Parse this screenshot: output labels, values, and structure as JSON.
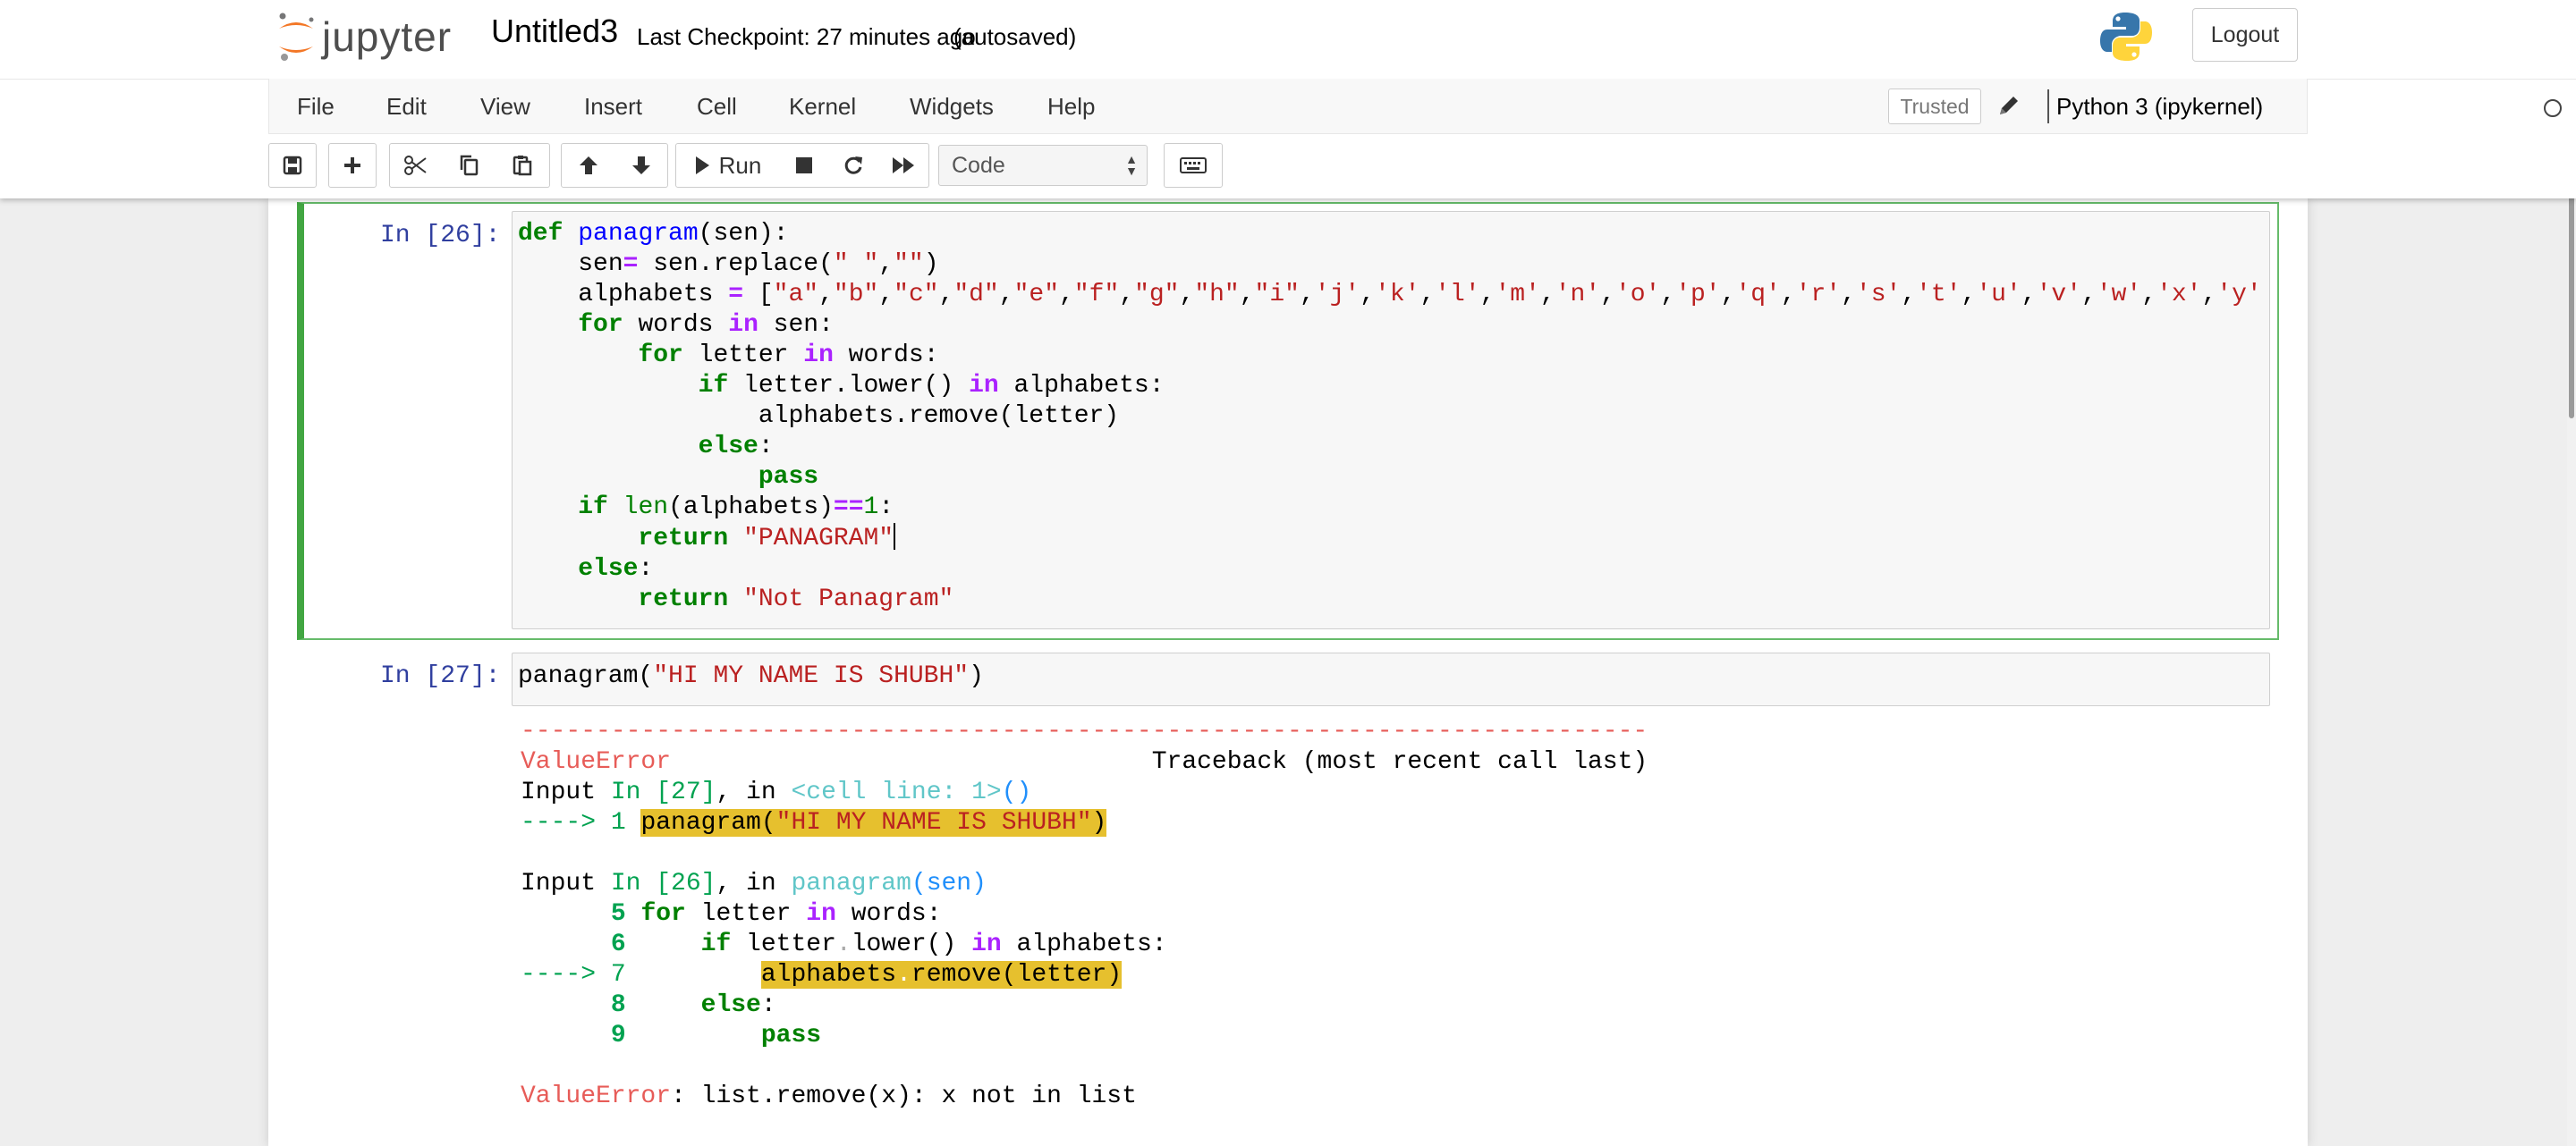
{
  "header": {
    "logo_text": "jupyter",
    "notebook_name": "Untitled3",
    "checkpoint": "Last Checkpoint: 27 minutes ago",
    "autosave": "(autosaved)",
    "logout_label": "Logout"
  },
  "menu": {
    "items": [
      "File",
      "Edit",
      "View",
      "Insert",
      "Cell",
      "Kernel",
      "Widgets",
      "Help"
    ],
    "trusted_label": "Trusted",
    "kernel_name": "Python 3 (ipykernel)"
  },
  "toolbar": {
    "run_label": "Run",
    "cell_type": "Code",
    "icons": [
      "save-icon",
      "plus-icon",
      "cut-icon",
      "copy-icon",
      "paste-icon",
      "arrow-up-icon",
      "arrow-down-icon",
      "run-icon",
      "stop-icon",
      "restart-icon",
      "fast-forward-icon",
      "keyboard-icon"
    ]
  },
  "cells": [
    {
      "prompt": "In [26]:",
      "code_lines": [
        "def panagram(sen):",
        "    sen= sen.replace(\" \",\"\")",
        "    alphabets = [\"a\",\"b\",\"c\",\"d\",\"e\",\"f\",\"g\",\"h\",\"i\",'j','k','l','m','n','o','p','q','r','s','t','u','v','w','x','y'",
        "    for words in sen:",
        "        for letter in words:",
        "            if letter.lower() in alphabets:",
        "                alphabets.remove(letter)",
        "            else:",
        "                pass",
        "    if len(alphabets)==1:",
        "        return \"PANAGRAM\"",
        "    else:",
        "        return \"Not Panagram\""
      ]
    },
    {
      "prompt": "In [27]:",
      "code_lines": [
        "panagram(\"HI MY NAME IS SHUBH\")"
      ],
      "output_lines": [
        "---------------------------------------------------------------------------",
        "ValueError                                Traceback (most recent call last)",
        "Input In [27], in <cell line: 1>()",
        "----> 1 panagram(\"HI MY NAME IS SHUBH\")",
        "",
        "Input In [26], in panagram(sen)",
        "      5 for letter in words:",
        "      6     if letter.lower() in alphabets:",
        "----> 7         alphabets.remove(letter)",
        "      8     else:",
        "      9         pass",
        "",
        "ValueError: list.remove(x): x not in list"
      ]
    }
  ]
}
